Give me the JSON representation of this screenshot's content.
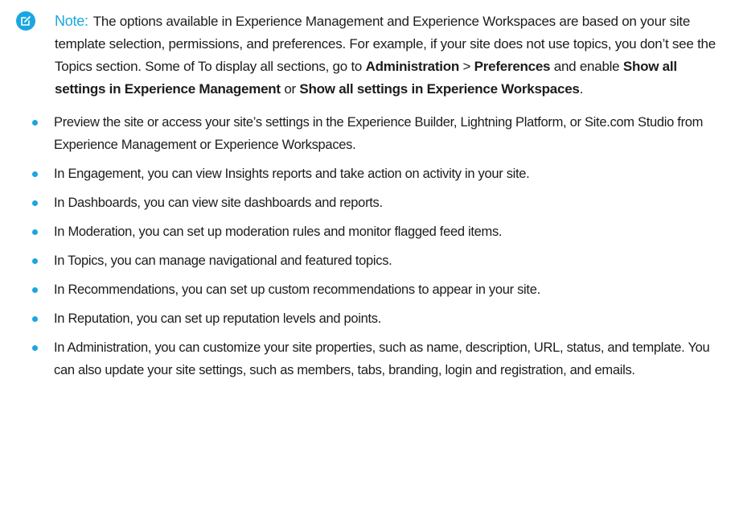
{
  "note": {
    "icon": "edit-note-icon",
    "accent_color": "#1aa7e0",
    "label": "Note:",
    "text_1": "The options available in Experience Management and Experience Workspaces are based on your site template selection, permissions, and preferences. For example, if your site does not use topics, you don’t see the Topics section. Some of To display all sections, go to ",
    "bold_administration": "Administration",
    "sep": " > ",
    "bold_preferences": "Preferences",
    "text_2": " and enable ",
    "bold_show_em": "Show all settings in Experience Management",
    "text_3": " or ",
    "bold_show_ew": "Show all settings in Experience Workspaces",
    "text_4": "."
  },
  "items": [
    "Preview the site or access your site’s settings in the Experience Builder, Lightning Platform, or Site.com Studio from Experience Management or Experience Workspaces.",
    "In Engagement, you can view Insights reports and take action on activity in your site.",
    "In Dashboards, you can view site dashboards and reports.",
    "In Moderation, you can set up moderation rules and monitor flagged feed items.",
    "In Topics, you can manage navigational and featured topics.",
    "In Recommendations, you can set up custom recommendations to appear in your site.",
    "In Reputation, you can set up reputation levels and points.",
    "In Administration, you can customize your site properties, such as name, description, URL, status, and template. You can also update your site settings, such as members, tabs, branding, login and registration, and emails."
  ]
}
